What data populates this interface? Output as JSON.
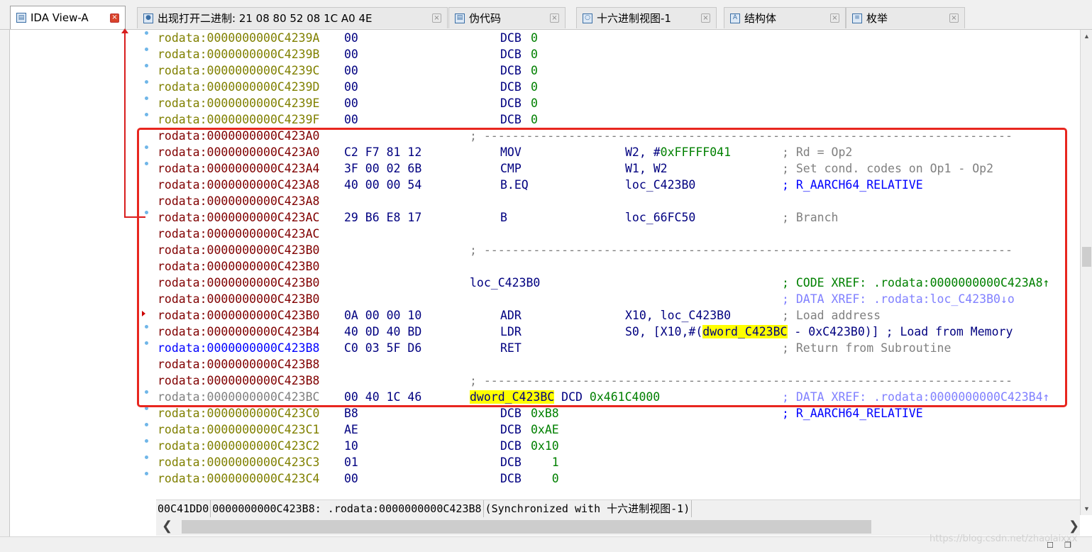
{
  "tabs": [
    {
      "label": "IDA View-A",
      "icon": "ida-view-icon",
      "active": true
    },
    {
      "label": "出现打开二进制: 21 08 80 52 08 1C A0 4E",
      "icon": "search-result-icon",
      "active": false
    },
    {
      "label": "伪代码",
      "icon": "pseudocode-icon",
      "active": false
    },
    {
      "label": "十六进制视图-1",
      "icon": "hex-view-icon",
      "active": false
    },
    {
      "label": "结构体",
      "icon": "structures-icon",
      "active": false
    },
    {
      "label": "枚举",
      "icon": "enums-icon",
      "active": false
    }
  ],
  "tab_close_glyph": "×",
  "colors": {
    "addr_data": "#808000",
    "addr_code": "#800000",
    "addr_current": "#0000ff",
    "addr_gray": "#808080",
    "number": "#008000",
    "xref_code": "#008000",
    "xref_data": "#8080ff",
    "highlight": "#ffff00",
    "annotation_red": "#e8261f"
  },
  "disasm_lines": [
    {
      "kind": "data",
      "addr": "rodata:0000000000C4239A",
      "bytes": "00",
      "mnem": "DCB",
      "ops": "0",
      "ops_color": "number",
      "dot": true
    },
    {
      "kind": "data",
      "addr": "rodata:0000000000C4239B",
      "bytes": "00",
      "mnem": "DCB",
      "ops": "0",
      "ops_color": "number",
      "dot": true
    },
    {
      "kind": "data",
      "addr": "rodata:0000000000C4239C",
      "bytes": "00",
      "mnem": "DCB",
      "ops": "0",
      "ops_color": "number",
      "dot": true
    },
    {
      "kind": "data",
      "addr": "rodata:0000000000C4239D",
      "bytes": "00",
      "mnem": "DCB",
      "ops": "0",
      "ops_color": "number",
      "dot": true
    },
    {
      "kind": "data",
      "addr": "rodata:0000000000C4239E",
      "bytes": "00",
      "mnem": "DCB",
      "ops": "0",
      "ops_color": "number",
      "dot": true
    },
    {
      "kind": "data",
      "addr": "rodata:0000000000C4239F",
      "bytes": "00",
      "mnem": "DCB",
      "ops": "0",
      "ops_color": "number",
      "dot": true
    },
    {
      "kind": "sep",
      "addr": "rodata:0000000000C423A0",
      "sep": "; ---------------------------------------------------------------------------",
      "dot": false
    },
    {
      "kind": "code",
      "addr": "rodata:0000000000C423A0",
      "bytes": "C2 F7 81 12",
      "mnem": "MOV",
      "ops_pre": "W2, #",
      "ops_num": "0xFFFFF041",
      "cmt": "; Rd = Op2",
      "dot": true
    },
    {
      "kind": "code",
      "addr": "rodata:0000000000C423A4",
      "bytes": "3F 00 02 6B",
      "mnem": "CMP",
      "ops": "W1, W2",
      "cmt": "; Set cond. codes on Op1 - Op2",
      "dot": true
    },
    {
      "kind": "code",
      "addr": "rodata:0000000000C423A8",
      "bytes": "40 00 00 54",
      "mnem": "B.EQ",
      "ops": "loc_C423B0",
      "cmt": "; R_AARCH64_RELATIVE",
      "cmt_color": "addr_current",
      "dot": false
    },
    {
      "kind": "code",
      "addr": "rodata:0000000000C423A8",
      "dot": false
    },
    {
      "kind": "code",
      "addr": "rodata:0000000000C423AC",
      "bytes": "29 B6 E8 17",
      "mnem": "B",
      "ops": "loc_66FC50",
      "cmt": "; Branch",
      "dot": true
    },
    {
      "kind": "code",
      "addr": "rodata:0000000000C423AC",
      "dot": false
    },
    {
      "kind": "sep",
      "addr": "rodata:0000000000C423B0",
      "sep": "; ---------------------------------------------------------------------------",
      "dot": false
    },
    {
      "kind": "code",
      "addr": "rodata:0000000000C423B0",
      "dot": false
    },
    {
      "kind": "code",
      "addr": "rodata:0000000000C423B0",
      "label": "loc_C423B0",
      "cmt": "; CODE XREF: .rodata:0000000000C423A8↑",
      "cmt_color": "xref_code",
      "dot": false
    },
    {
      "kind": "code",
      "addr": "rodata:0000000000C423B0",
      "cmt": "; DATA XREF: .rodata:loc_C423B0↓o",
      "cmt_color": "xref_data",
      "dot": false
    },
    {
      "kind": "code",
      "addr": "rodata:0000000000C423B0",
      "bytes": "0A 00 00 10",
      "mnem": "ADR",
      "ops": "X10, loc_C423B0",
      "cmt": "; Load address",
      "dot": false,
      "arrow": true
    },
    {
      "kind": "code",
      "addr": "rodata:0000000000C423B4",
      "bytes": "40 0D 40 BD",
      "mnem": "LDR",
      "ops_pre": "S0, [X10,#(",
      "ops_hl": "dword_C423BC",
      "ops_post": " - 0xC423B0)] ; Load from Memory",
      "dot": true
    },
    {
      "kind": "current",
      "addr": "rodata:0000000000C423B8",
      "bytes": "C0 03 5F D6",
      "mnem": "RET",
      "cmt": "; Return from Subroutine",
      "dot": true
    },
    {
      "kind": "code",
      "addr": "rodata:0000000000C423B8",
      "dot": false
    },
    {
      "kind": "sep",
      "addr": "rodata:0000000000C423B8",
      "sep": "; ---------------------------------------------------------------------------",
      "dot": false
    },
    {
      "kind": "gray",
      "addr": "rodata:0000000000C423BC",
      "bytes": "00 40 1C 46",
      "label_hl": "dword_C423BC",
      "mnem_inline": "DCD",
      "ops_num_inline": "0x461C4000",
      "cmt": "; DATA XREF: .rodata:0000000000C423B4↑",
      "cmt_color": "xref_data",
      "dot": true
    },
    {
      "kind": "data",
      "addr": "rodata:0000000000C423C0",
      "bytes": "B8",
      "mnem": "DCB",
      "ops": "0xB8",
      "ops_color": "number",
      "cmt": "; R_AARCH64_RELATIVE",
      "cmt_color": "addr_current",
      "dot": true
    },
    {
      "kind": "data",
      "addr": "rodata:0000000000C423C1",
      "bytes": "AE",
      "mnem": "DCB",
      "ops": "0xAE",
      "ops_color": "number",
      "dot": true
    },
    {
      "kind": "data",
      "addr": "rodata:0000000000C423C2",
      "bytes": "10",
      "mnem": "DCB",
      "ops": "0x10",
      "ops_color": "number",
      "dot": true
    },
    {
      "kind": "data",
      "addr": "rodata:0000000000C423C3",
      "bytes": "01",
      "mnem": "DCB",
      "ops": "   1",
      "ops_color": "number",
      "dot": true
    },
    {
      "kind": "data",
      "addr": "rodata:0000000000C423C4",
      "bytes": "00",
      "mnem": "DCB",
      "ops": "   0",
      "ops_color": "number",
      "dot": true
    }
  ],
  "status": {
    "offset": "00C41DD0",
    "location": "0000000000C423B8: .rodata:0000000000C423B8",
    "sync": "(Synchronized with 十六进制视图-1)"
  },
  "watermark": "https://blog.csdn.net/zhaolaixxx"
}
